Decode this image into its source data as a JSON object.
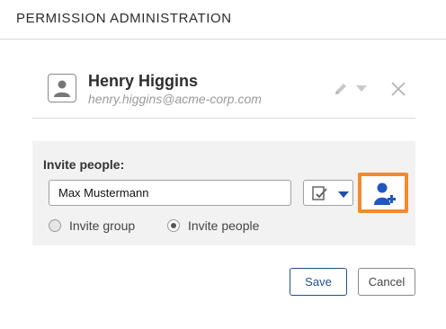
{
  "header": {
    "title": "PERMISSION ADMINISTRATION"
  },
  "user": {
    "name": "Henry Higgins",
    "email": "henry.higgins@acme-corp.com"
  },
  "invite": {
    "label": "Invite people:",
    "name_value": "Max Mustermann",
    "options": [
      {
        "label": "Invite group",
        "selected": false
      },
      {
        "label": "Invite people",
        "selected": true
      }
    ]
  },
  "footer": {
    "save_label": "Save",
    "cancel_label": "Cancel"
  },
  "icons": {
    "user_avatar": "user-silhouette",
    "edit": "pencil",
    "close": "close-x",
    "permission": "checklist",
    "add_user": "add-user"
  },
  "colors": {
    "accent_blue": "#1f4f8f",
    "add_user_icon": "#1f56c0",
    "highlight_orange": "#f28a2e",
    "panel_bg": "#f2f2f2"
  }
}
